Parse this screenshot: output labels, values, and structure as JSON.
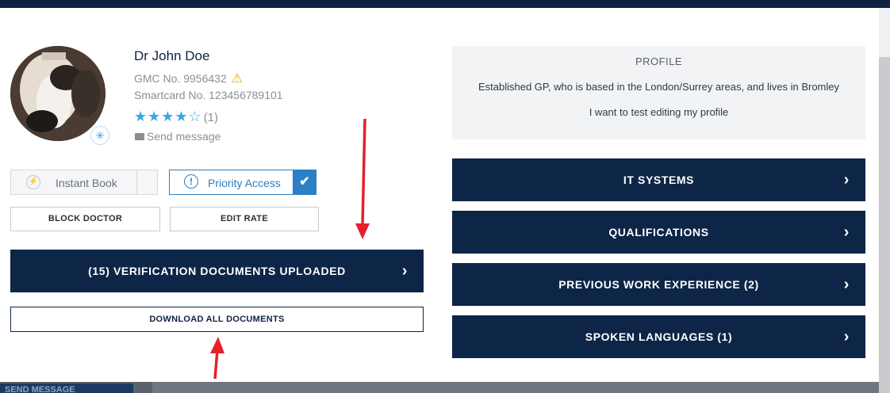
{
  "background": {
    "send_message_label": "SEND MESSAGE"
  },
  "doctor": {
    "name": "Dr John Doe",
    "gmc": "GMC No. 9956432",
    "smartcard": "Smartcard No. 123456789101",
    "rating_stars": "★★★★☆",
    "rating_value": 4,
    "rating_count": "(1)",
    "send_message": "Send message"
  },
  "actions": {
    "instant_book": "Instant Book",
    "priority_access": "Priority Access",
    "priority_checked": true,
    "block_doctor": "BLOCK DOCTOR",
    "edit_rate": "EDIT RATE",
    "verification": "(15) VERIFICATION DOCUMENTS UPLOADED",
    "download_all": "DOWNLOAD ALL DOCUMENTS"
  },
  "profile": {
    "title": "PROFILE",
    "line1": "Established GP, who is based in the London/Surrey areas, and lives in Bromley",
    "line2": "I want to test editing my profile"
  },
  "sections": [
    {
      "label": "IT SYSTEMS"
    },
    {
      "label": "QUALIFICATIONS"
    },
    {
      "label": "PREVIOUS WORK EXPERIENCE (2)"
    },
    {
      "label": "SPOKEN LANGUAGES (1)"
    }
  ],
  "colors": {
    "navy": "#0d2546",
    "accent_blue": "#2b7fc4",
    "star_blue": "#3aa6e0",
    "warning": "#f0a416",
    "annotation_red": "#e5202a"
  },
  "icons": {
    "warning": "warning-triangle-icon",
    "envelope": "envelope-icon",
    "lightning": "lightning-icon",
    "info": "exclamation-circle-icon",
    "check": "checkmark-icon",
    "chevron": "chevron-right-icon"
  }
}
